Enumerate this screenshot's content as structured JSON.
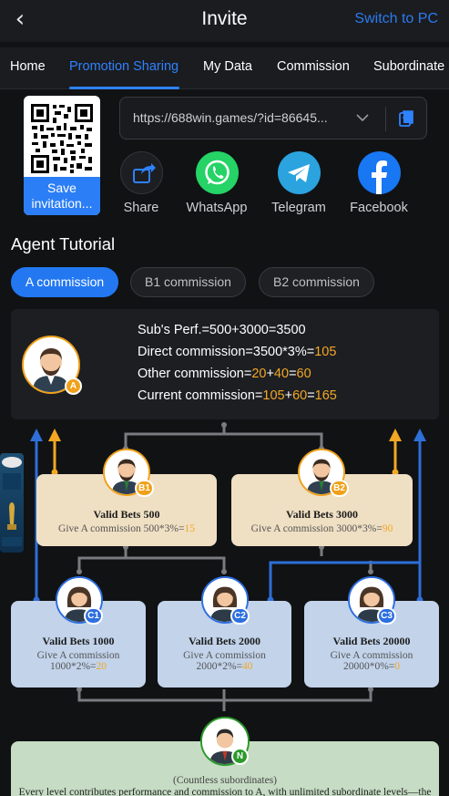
{
  "header": {
    "title": "Invite",
    "switch_label": "Switch to PC"
  },
  "tabs": [
    "Home",
    "Promotion Sharing",
    "My Data",
    "Commission",
    "Subordinate"
  ],
  "active_tab": "Promotion Sharing",
  "qr": {
    "save_label": "Save invitation..."
  },
  "invite_link": {
    "value": "https://688win.games/?id=86645..."
  },
  "share": {
    "items": [
      {
        "label": "Share",
        "icon": "share-icon"
      },
      {
        "label": "WhatsApp",
        "icon": "whatsapp-icon"
      },
      {
        "label": "Telegram",
        "icon": "telegram-icon"
      },
      {
        "label": "Facebook",
        "icon": "facebook-icon"
      }
    ]
  },
  "tutorial": {
    "title": "Agent Tutorial",
    "pills": [
      "A commission",
      "B1 commission",
      "B2 commission"
    ],
    "active_pill": "A commission",
    "summary": {
      "badge": "A",
      "perf": "Sub's Perf.=500+3000=3500",
      "direct_prefix": "Direct commission=3500*3%=",
      "direct_value": "105",
      "other_prefix": "Other commission=",
      "other_a": "20",
      "other_plus": "+",
      "other_b": "40",
      "other_eq": "=",
      "other_total": "60",
      "current_prefix": "Current commission=",
      "current_a": "105",
      "current_plus": "+",
      "current_b": "60",
      "current_eq": "=",
      "current_total": "165"
    },
    "nodes": {
      "b1": {
        "badge": "B1",
        "title": "Valid Bets 500",
        "line1_prefix": "Give A commission 500*3%=",
        "line1_value": "15"
      },
      "b2": {
        "badge": "B2",
        "title": "Valid Bets 3000",
        "line1_prefix": "Give A commission 3000*3%=",
        "line1_value": "90"
      },
      "c1": {
        "badge": "C1",
        "title": "Valid Bets 1000",
        "line1": "Give A commission",
        "line2_prefix": "1000*2%=",
        "line2_value": "20"
      },
      "c2": {
        "badge": "C2",
        "title": "Valid Bets 2000",
        "line1": "Give A commission",
        "line2_prefix": "2000*2%=",
        "line2_value": "40"
      },
      "c3": {
        "badge": "C3",
        "title": "Valid Bets 20000",
        "line1": "Give A commission",
        "line2_prefix": "20000*0%=",
        "line2_value": "0"
      },
      "n": {
        "badge": "N",
        "title": "(Countless subordinates)",
        "line1": "Every level contributes performance and commission to A, with unlimited subordinate levels—the"
      }
    }
  },
  "colors": {
    "accent": "#2e82ff",
    "highlight": "#f2a825",
    "tan_box": "#efdfc3",
    "blue_box": "#c2d3ea",
    "green_box": "#c6dcc4",
    "badge_orange": "#f0a11a",
    "badge_blue": "#2d6fe0",
    "badge_green": "#2b9a2b"
  }
}
